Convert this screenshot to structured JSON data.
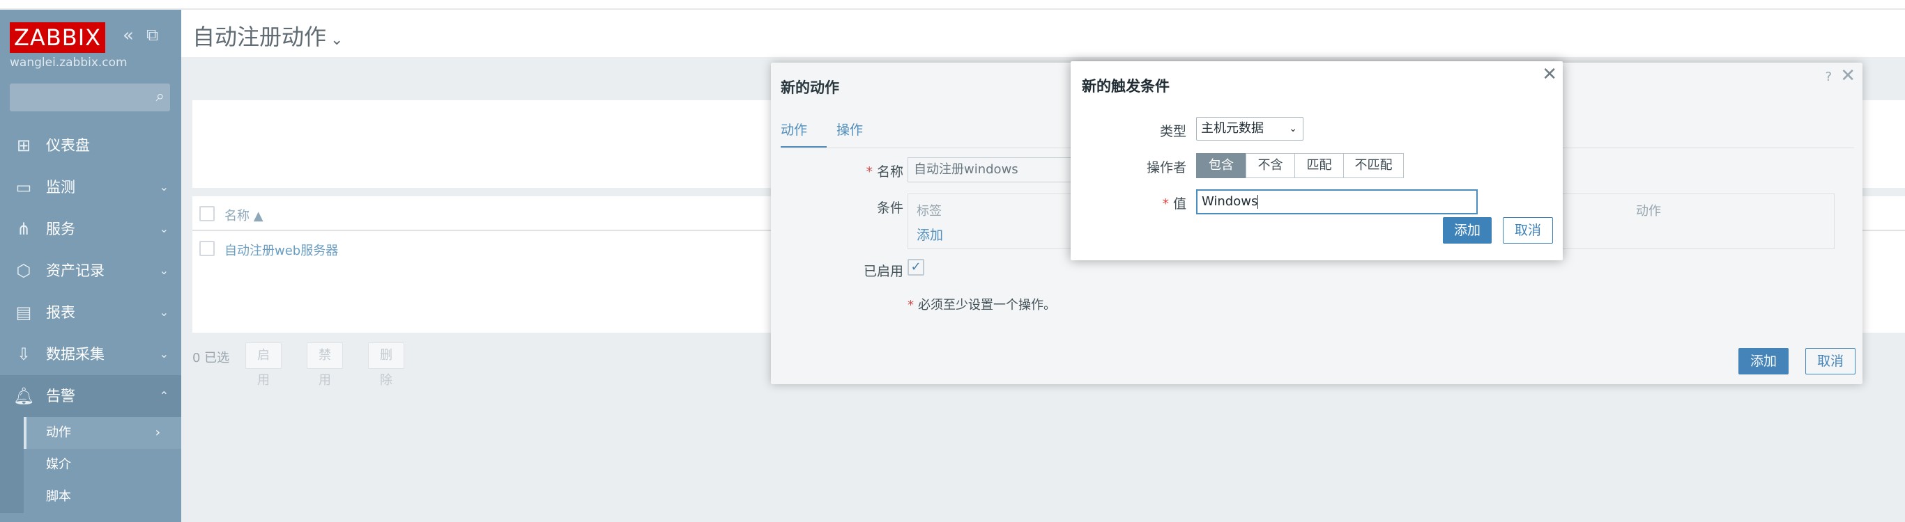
{
  "sidebar": {
    "logo": "ZABBIX",
    "server": "wanglei.zabbix.com",
    "search_placeholder": "",
    "collapse_icon": "double-chevron-left-icon",
    "kiosk_icon": "kiosk-mode-icon",
    "menu": [
      {
        "label": "仪表盘",
        "icon": "dashboard-icon",
        "arrow": ""
      },
      {
        "label": "监测",
        "icon": "monitoring-icon",
        "arrow": "⌄"
      },
      {
        "label": "服务",
        "icon": "services-icon",
        "arrow": "⌄"
      },
      {
        "label": "资产记录",
        "icon": "inventory-icon",
        "arrow": "⌄"
      },
      {
        "label": "报表",
        "icon": "reports-icon",
        "arrow": "⌄"
      },
      {
        "label": "数据采集",
        "icon": "data-collection-icon",
        "arrow": "⌄"
      },
      {
        "label": "告警",
        "icon": "bell-icon",
        "arrow": "⌃"
      }
    ],
    "submenu": [
      {
        "label": "动作",
        "arrow": "›"
      },
      {
        "label": "媒介"
      },
      {
        "label": "脚本"
      }
    ]
  },
  "page": {
    "title": "自动注册动作",
    "title_caret": "⌄"
  },
  "table": {
    "col_name": "名称 ▲",
    "col_action": "动作",
    "rows": [
      {
        "name": "自动注册web服务器"
      }
    ]
  },
  "bulk": {
    "selected": "0 已选",
    "enable": "启用",
    "disable": "禁用",
    "delete": "删除"
  },
  "action_dialog": {
    "title": "新的动作",
    "help": "?",
    "close": "✕",
    "tabs": [
      "动作",
      "操作"
    ],
    "name_label": "名称",
    "name_value": "自动注册windows",
    "conditions_label": "条件",
    "cond_col_label": "标签",
    "cond_col_action": "动作",
    "cond_add": "添加",
    "enabled_label": "已启用",
    "enabled_check": "✓",
    "warning": "必须至少设置一个操作。",
    "add_button": "添加",
    "cancel_button": "取消"
  },
  "condition_dialog": {
    "title": "新的触发条件",
    "close": "✕",
    "type_label": "类型",
    "type_value": "主机元数据",
    "operator_label": "操作者",
    "operators": [
      "包含",
      "不含",
      "匹配",
      "不匹配"
    ],
    "operator_selected": 0,
    "value_label": "值",
    "value": "Windows",
    "add_button": "添加",
    "cancel_button": "取消"
  },
  "colors": {
    "sidebar": "#7b9cb3",
    "accent": "#3e82ba",
    "logo": "#d40000",
    "required": "#d64541"
  }
}
